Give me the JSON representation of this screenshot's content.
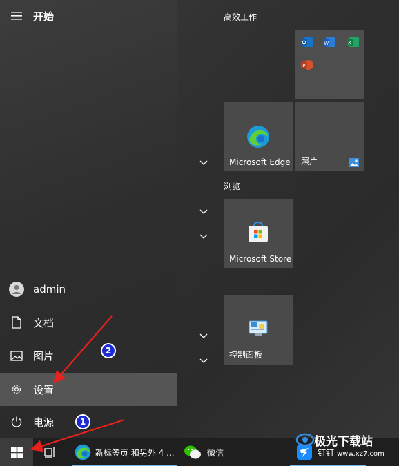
{
  "start_menu": {
    "title": "开始",
    "user": "admin",
    "nav_items": [
      {
        "label": "文档",
        "icon": "document-icon"
      },
      {
        "label": "图片",
        "icon": "pictures-icon"
      },
      {
        "label": "设置",
        "icon": "gear-icon"
      },
      {
        "label": "电源",
        "icon": "power-icon"
      }
    ]
  },
  "tiles": {
    "group1_label": "高效工作",
    "group2_label": "浏览",
    "edge_label": "Microsoft Edge",
    "photos_label": "照片",
    "store_label": "Microsoft Store",
    "control_panel_label": "控制面板"
  },
  "taskbar": {
    "edge_label": "新标签页 和另外 4 ...",
    "wechat_label": "微信",
    "dingtalk_label": "钉钉"
  },
  "annotations": {
    "step1": "1",
    "step2": "2"
  },
  "watermark": {
    "brand": "极光下载站",
    "url": "www.xz7.com"
  },
  "colors": {
    "accent": "#76b9ed",
    "active_item": "#555555",
    "badge": "#1d2bd4",
    "arrow": "#e8211d"
  }
}
